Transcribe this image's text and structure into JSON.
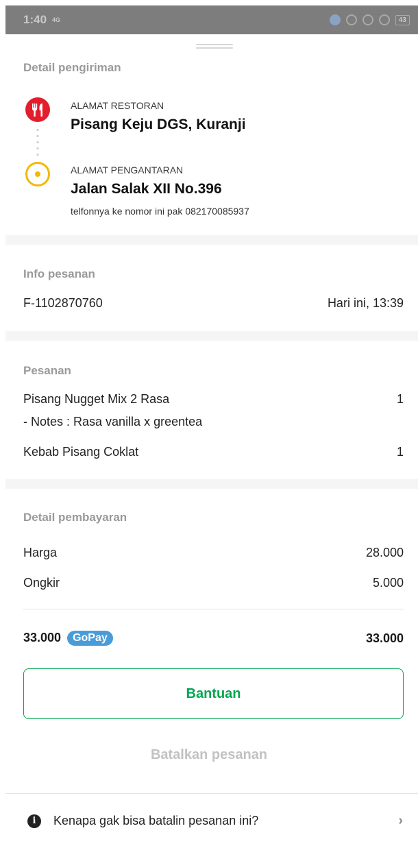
{
  "status_bar": {
    "time": "1:40",
    "signal_text": "4G",
    "battery": "43"
  },
  "delivery": {
    "title": "Detail pengiriman",
    "restaurant_label": "ALAMAT RESTORAN",
    "restaurant_name": "Pisang Keju DGS, Kuranji",
    "destination_label": "ALAMAT PENGANTARAN",
    "destination_name": "Jalan Salak XII No.396",
    "destination_note": "telfonnya ke nomor ini pak 082170085937"
  },
  "order_info": {
    "title": "Info pesanan",
    "order_id": "F-1102870760",
    "time": "Hari ini, 13:39"
  },
  "order": {
    "title": "Pesanan",
    "items": [
      {
        "name": "Pisang Nugget Mix 2 Rasa",
        "qty": "1",
        "note": "- Notes : Rasa vanilla x greentea"
      },
      {
        "name": "Kebab Pisang Coklat",
        "qty": "1"
      }
    ]
  },
  "payment": {
    "title": "Detail pembayaran",
    "price_label": "Harga",
    "price_value": "28.000",
    "delivery_label": "Ongkir",
    "delivery_value": "5.000",
    "total_method_amount": "33.000",
    "method": "GoPay",
    "total_value": "33.000"
  },
  "actions": {
    "help_label": "Bantuan",
    "cancel_label": "Batalkan pesanan",
    "info_text": "Kenapa gak bisa batalin pesanan ini?"
  },
  "colors": {
    "accent_green": "#00a54f",
    "restaurant_red": "#e31d2b",
    "destination_yellow": "#f5b800",
    "gopay_blue": "#4a9cd8"
  }
}
